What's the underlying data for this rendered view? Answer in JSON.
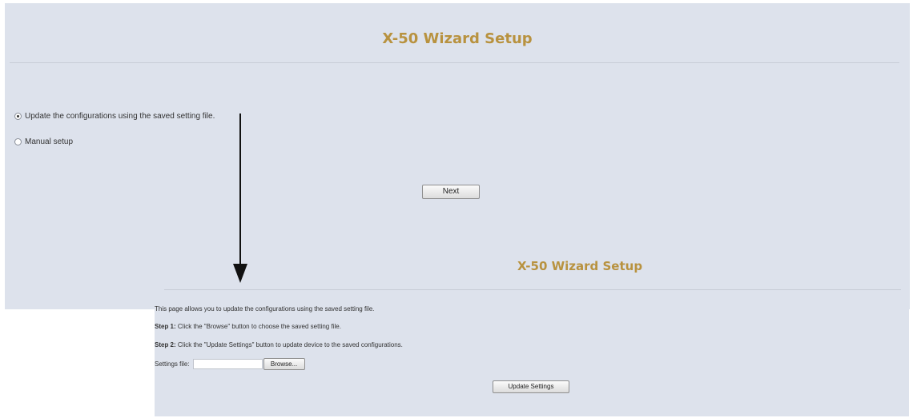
{
  "top": {
    "title": "X-50 Wizard Setup",
    "options": [
      {
        "label": "Update the configurations using the saved setting file.",
        "checked": true
      },
      {
        "label": "Manual setup",
        "checked": false
      }
    ],
    "next_label": "Next"
  },
  "bottom": {
    "title": "X-50 Wizard Setup",
    "intro": "This page allows you to update the configurations using the saved setting file.",
    "step1_label": "Step 1:",
    "step1_text": "Click the \"Browse\" button to choose the saved setting file.",
    "step2_label": "Step 2:",
    "step2_text": "Click the \"Update Settings\" button to update device to the saved configurations.",
    "settings_file_label": "Settings file:",
    "settings_file_value": "",
    "browse_label": "Browse...",
    "update_label": "Update Settings"
  },
  "colors": {
    "panel_bg": "#dde2ec",
    "title_color": "#b8923f"
  }
}
